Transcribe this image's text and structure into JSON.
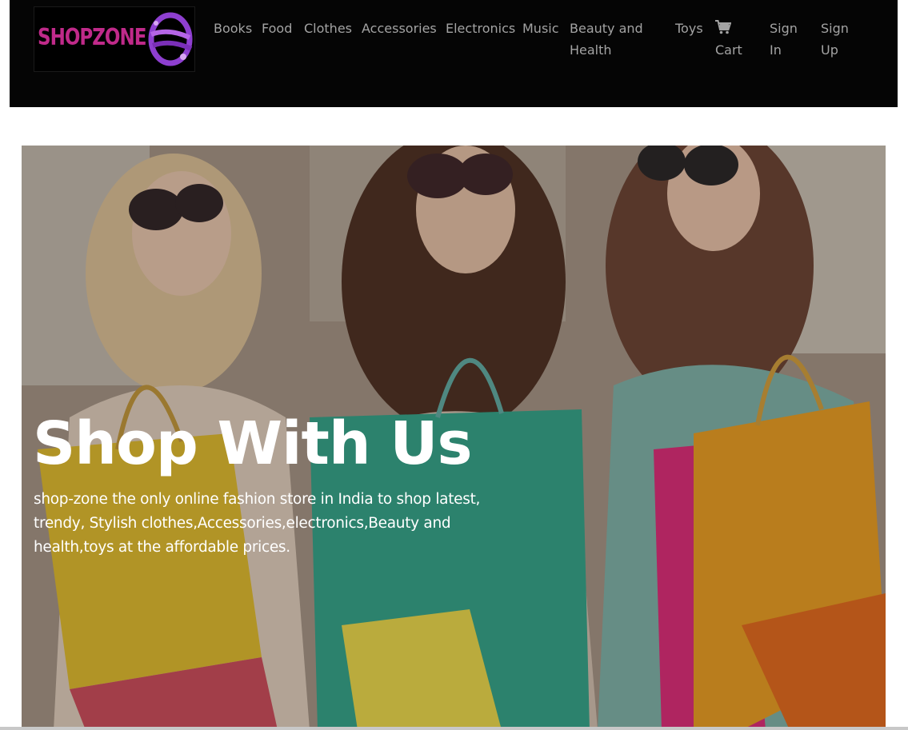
{
  "brand": {
    "logo_text": "SHOPZONE"
  },
  "nav": {
    "items": [
      {
        "label": "Books"
      },
      {
        "label": "Food"
      },
      {
        "label": "Clothes"
      },
      {
        "label": "Accessories"
      },
      {
        "label": "Electronics"
      },
      {
        "label": "Music"
      },
      {
        "label": "Beauty and Health"
      },
      {
        "label": "Toys"
      }
    ],
    "cart": {
      "label": "Cart",
      "icon": "cart-icon"
    },
    "sign_in": {
      "label": "Sign In"
    },
    "sign_up": {
      "label": "Sign Up"
    }
  },
  "hero": {
    "title": "Shop With Us",
    "description": "shop-zone the only online fashion store in India to shop latest, trendy, Stylish clothes,Accessories,electronics,Beauty and health,toys at the affordable prices."
  },
  "colors": {
    "navbar_bg": "#050505",
    "nav_text": "#a3a3a3",
    "logo_pink": "#c02a8a",
    "logo_purple": "#8e3fd0",
    "hero_text": "#ffffff"
  }
}
